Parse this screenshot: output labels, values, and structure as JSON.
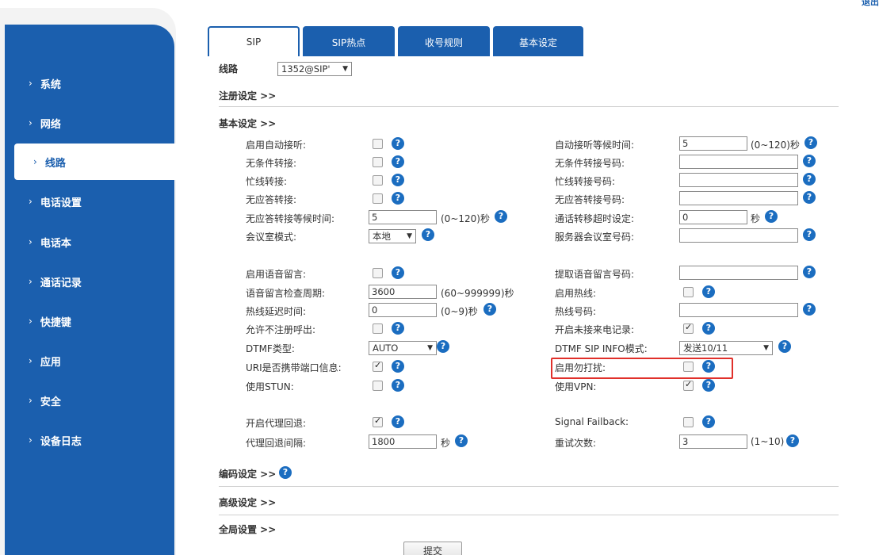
{
  "header": {
    "corner_text": "退出"
  },
  "sidebar": {
    "items": [
      {
        "label": "系统"
      },
      {
        "label": "网络"
      },
      {
        "label": "线路"
      },
      {
        "label": "电话设置"
      },
      {
        "label": "电话本"
      },
      {
        "label": "通话记录"
      },
      {
        "label": "快捷键"
      },
      {
        "label": "应用"
      },
      {
        "label": "安全"
      },
      {
        "label": "设备日志"
      }
    ],
    "active": "线路",
    "chevron": "›"
  },
  "tabs": [
    {
      "label": "SIP"
    },
    {
      "label": "SIP热点"
    },
    {
      "label": "收号规则"
    },
    {
      "label": "基本设定"
    }
  ],
  "line": {
    "label": "线路",
    "value": "1352@SIP'"
  },
  "sections": {
    "register": "注册设定 >>",
    "basic": "基本设定 >>",
    "codec": "编码设定 >>",
    "advanced": "高级设定 >>",
    "global": "全局设置 >>"
  },
  "help_glyph": "?",
  "select_arrow": "▼",
  "left_col": {
    "auto_answer": "启用自动接听:",
    "unconditional_fwd": "无条件转接:",
    "busy_fwd": "忙线转接:",
    "noanswer_fwd": "无应答转接:",
    "noanswer_wait": "无应答转接等候时间:",
    "noanswer_wait_value": "5",
    "noanswer_wait_unit": "(0~120)秒",
    "conference_mode": "会议室模式:",
    "conference_mode_value": "本地",
    "voicemail_enable": "启用语音留言:",
    "voicemail_check": "语音留言检查周期:",
    "voicemail_check_value": "3600",
    "voicemail_check_unit": "(60~999999)秒",
    "hotline_delay": "热线延迟时间:",
    "hotline_delay_value": "0",
    "hotline_delay_unit": "(0~9)秒",
    "allow_unregistered": "允许不注册呼出:",
    "dtmf_type": "DTMF类型:",
    "dtmf_type_value": "AUTO",
    "uri_port": "URI是否携带端口信息:",
    "use_stun": "使用STUN:",
    "proxy_fallback": "开启代理回退:",
    "fallback_interval": "代理回退间隔:",
    "fallback_interval_value": "1800",
    "fallback_interval_unit": "秒"
  },
  "right_col": {
    "auto_answer_wait": "自动接听等候时间:",
    "auto_answer_wait_value": "5",
    "auto_answer_wait_unit": "(0~120)秒",
    "unconditional_fwd_num": "无条件转接号码:",
    "busy_fwd_num": "忙线转接号码:",
    "noanswer_fwd_num": "无应答转接号码:",
    "transfer_timeout": "通话转移超时设定:",
    "transfer_timeout_value": "0",
    "transfer_timeout_unit": "秒",
    "server_conf_num": "服务器会议室号码:",
    "voicemail_num": "提取语音留言号码:",
    "hotline_enable": "启用热线:",
    "hotline_num": "热线号码:",
    "missed_log": "开启未接来电记录:",
    "dtmf_sip_info": "DTMF SIP INFO模式:",
    "dtmf_sip_info_value": "发送10/11",
    "dnd_enable": "启用勿打扰:",
    "use_vpn": "使用VPN:",
    "signal_failback": "Signal Failback:",
    "retry_count": "重试次数:",
    "retry_count_value": "3",
    "retry_count_unit": "(1~10)"
  },
  "submit_label": "提交",
  "colors": {
    "brand": "#1b5fae",
    "highlight": "#e0302a"
  }
}
